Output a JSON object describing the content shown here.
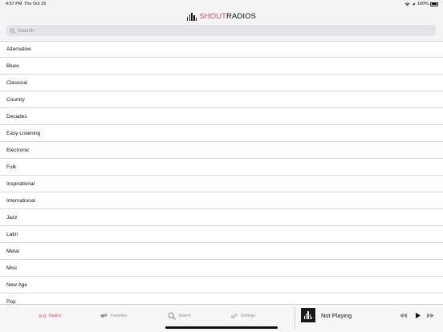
{
  "status_bar": {
    "time": "4:57 PM",
    "date": "Thu Oct 29",
    "battery": "100%"
  },
  "header": {
    "logo_shout": "SHOUT",
    "logo_radios": "RADIOS"
  },
  "search": {
    "placeholder": "Search",
    "value": ""
  },
  "genres": [
    "Alternative",
    "Blues",
    "Classical",
    "Country",
    "Decades",
    "Easy Listening",
    "Electronic",
    "Folk",
    "Inspirational",
    "International",
    "Jazz",
    "Latin",
    "Metal",
    "Misc",
    "New Age",
    "Pop"
  ],
  "tabs": [
    {
      "label": "Radios",
      "icon": "radio-waves-icon",
      "active": true
    },
    {
      "label": "Favorites",
      "icon": "hearts-icon",
      "active": false
    },
    {
      "label": "Search",
      "icon": "search-icon",
      "active": false
    },
    {
      "label": "Settings",
      "icon": "gears-icon",
      "active": false
    }
  ],
  "now_playing": {
    "title": "Not Playing",
    "artwork_icon": "shout-radios-logo"
  },
  "colors": {
    "accent": "#e0475e",
    "tab_inactive": "#8e8e93"
  }
}
